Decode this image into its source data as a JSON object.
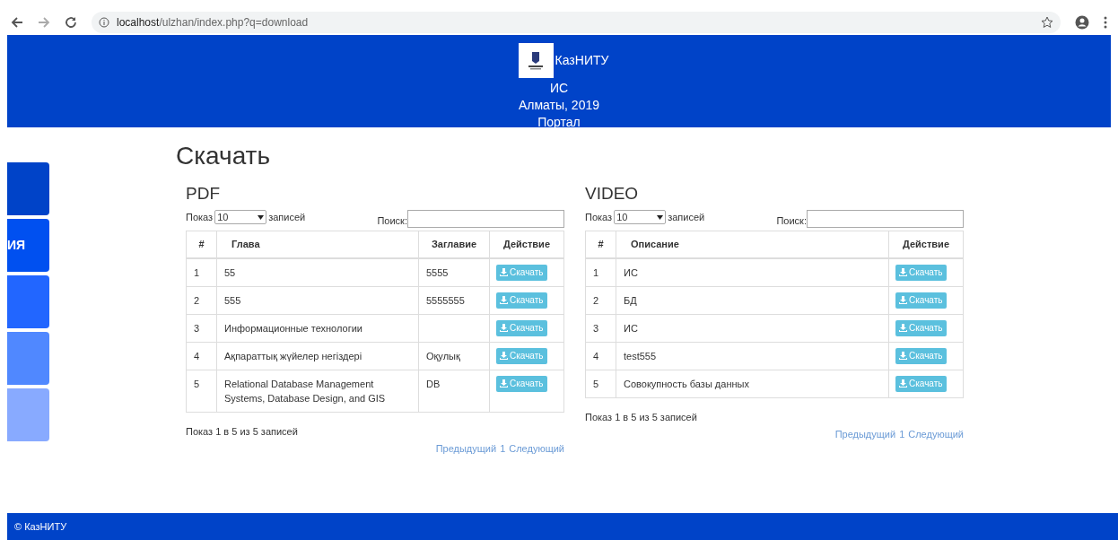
{
  "browser": {
    "url_host": "localhost",
    "url_path": "/ulzhan/index.php?q=download"
  },
  "header": {
    "brand": "КазНИТУ",
    "lines": [
      "ИС",
      "Алматы, 2019",
      "Портал"
    ]
  },
  "sidebar": {
    "tiles": [
      {
        "color": "#0043c8"
      },
      {
        "label": "ИЯ",
        "color": "#0050f0"
      },
      {
        "color": "#2266ff"
      },
      {
        "color": "#5088ff"
      },
      {
        "color": "#88aaff"
      }
    ]
  },
  "page_title": "Скачать",
  "tables": [
    {
      "title": "PDF",
      "length_prefix": "Показ",
      "length_value": "10",
      "length_suffix": "записей",
      "search_label": "Поиск:",
      "columns": [
        "#",
        "Глава",
        "Заглавие",
        "Действие"
      ],
      "rows": [
        {
          "cells": [
            "1",
            "55",
            "5555"
          ],
          "action": "Скачать"
        },
        {
          "cells": [
            "2",
            "555",
            "5555555"
          ],
          "action": "Скачать"
        },
        {
          "cells": [
            "3",
            "Информационные технологии",
            ""
          ],
          "action": "Скачать"
        },
        {
          "cells": [
            "4",
            "Ақпараттық жүйелер негіздері",
            "Оқулық"
          ],
          "action": "Скачать"
        },
        {
          "cells": [
            "5",
            "Relational Database Management Systems, Database Design, and GIS",
            "DB"
          ],
          "action": "Скачать"
        }
      ],
      "info": "Показ 1 в 5 из 5 записей",
      "pagination": [
        "Предыдущий",
        "1",
        "Следующий"
      ]
    },
    {
      "title": "VIDEO",
      "length_prefix": "Показ",
      "length_value": "10",
      "length_suffix": "записей",
      "search_label": "Поиск:",
      "columns": [
        "#",
        "Описание",
        "Действие"
      ],
      "rows": [
        {
          "cells": [
            "1",
            "ИС"
          ],
          "action": "Скачать"
        },
        {
          "cells": [
            "2",
            "БД"
          ],
          "action": "Скачать"
        },
        {
          "cells": [
            "3",
            "ИС"
          ],
          "action": "Скачать"
        },
        {
          "cells": [
            "4",
            "test555"
          ],
          "action": "Скачать"
        },
        {
          "cells": [
            "5",
            "Совокупность базы данных"
          ],
          "action": "Скачать"
        }
      ],
      "info": "Показ 1 в 5 из 5 записей",
      "pagination": [
        "Предыдущий",
        "1",
        "Следующий"
      ]
    }
  ],
  "footer": "© КазНИТУ"
}
